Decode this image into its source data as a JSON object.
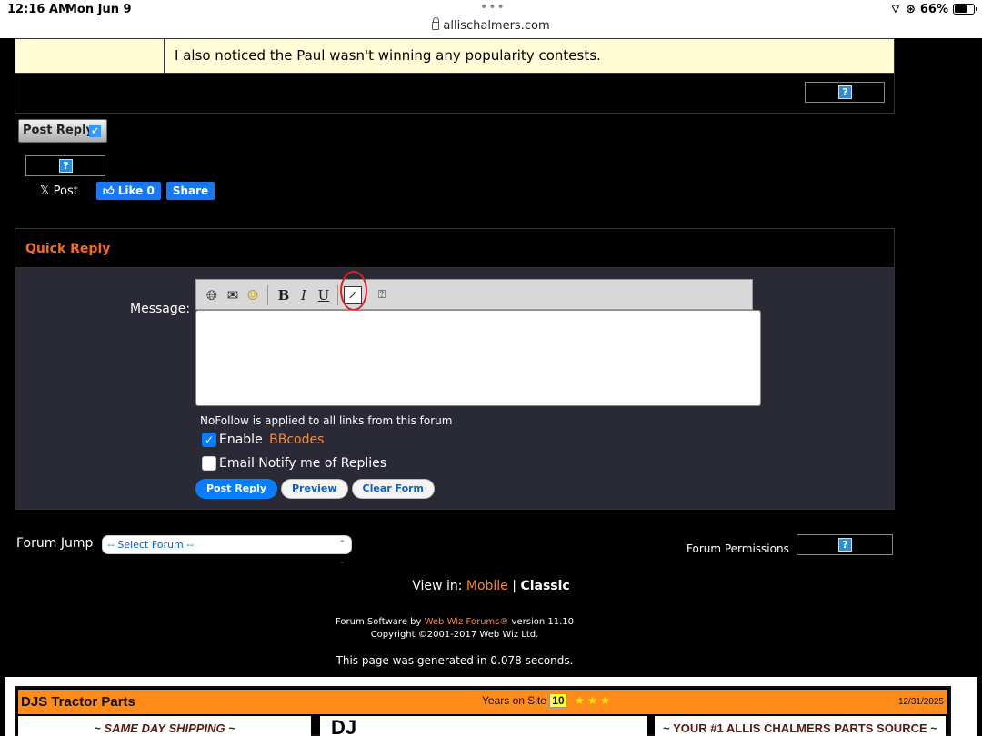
{
  "status_bar": {
    "time": "12:16 AM",
    "date": "Mon Jun 9",
    "url": "allischalmers.com",
    "battery": "66%",
    "battery_level_percent": 66
  },
  "post": {
    "text": "I also noticed the Paul wasn't winning any popularity contests."
  },
  "toolbar_buttons": {
    "post_reply": "Post Reply"
  },
  "social": {
    "x_post": "Post",
    "fb_like": "Like 0",
    "fb_share": "Share"
  },
  "quick_reply": {
    "title": "Quick Reply",
    "message_label": "Message:",
    "editor_tools": {
      "bold": "B",
      "italic": "I",
      "underline": "U"
    },
    "nofollow_note": "NoFollow is applied to all links from this forum",
    "enable_prefix": "Enable ",
    "bbcodes_link": "BBcodes",
    "enable_bbcodes_checked": true,
    "email_notify": "Email Notify me of Replies",
    "email_notify_checked": false,
    "buttons": {
      "post_reply": "Post Reply",
      "preview": "Preview",
      "clear_form": "Clear Form"
    }
  },
  "forum_jump": {
    "label": "Forum Jump",
    "selected": "-- Select Forum --"
  },
  "forum_permissions": "Forum Permissions",
  "view_in": {
    "prefix": "View in: ",
    "mobile": "Mobile",
    "separator": " | ",
    "classic": "Classic"
  },
  "credits": {
    "line1_prefix": "Forum Software by ",
    "line1_link": "Web Wiz Forums®",
    "line1_suffix": " version 11.10",
    "line2": "Copyright ©2001-2017 Web Wiz Ltd."
  },
  "generated": "This page was generated in 0.078 seconds.",
  "ad": {
    "name": "DJS Tractor Parts",
    "years_label": "Years on Site",
    "years": "10",
    "stars": "★ ★ ★",
    "date": "12/31/2025",
    "left_slogan": "~ SAME DAY SHIPPING ~",
    "mid_text": "DJ",
    "right_slogan": "~ YOUR #1 ALLIS CHALMERS PARTS SOURCE ~"
  },
  "colors": {
    "accent_orange": "#f26d21",
    "post_bg": "#fffcd6",
    "quick_reply_bg": "#2a2a36",
    "primary_blue": "#0a7cff"
  }
}
